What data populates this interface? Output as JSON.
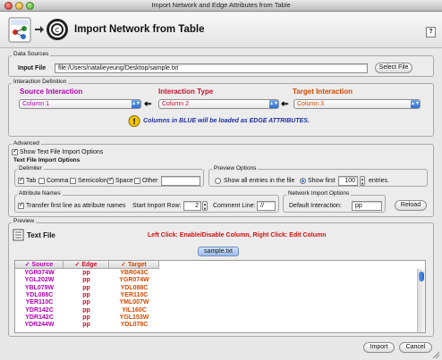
{
  "window": {
    "title": "Import Network and Edge Attributes from Table"
  },
  "header": {
    "title": "Import Network from Table",
    "help_label": "?"
  },
  "data_sources": {
    "legend": "Data Sources",
    "input_label": "Input File",
    "input_value": "file:/Users/natalieyeung/Desktop/sample.txt",
    "select_button": "Select File"
  },
  "interaction": {
    "legend": "Interaction Definition",
    "source_label": "Source Interaction",
    "type_label": "Interaction Type",
    "target_label": "Target Interaction",
    "source_value": "Column 1",
    "type_value": "Column 2",
    "target_value": "Column 3",
    "swap_symbol": "◆▸",
    "note": "Columns in BLUE will be loaded as EDGE ATTRIBUTES.",
    "colors": {
      "source": "#b000b0",
      "type": "#c8102e",
      "target": "#d04a00",
      "note": "#1f2fa6"
    }
  },
  "advanced": {
    "legend": "Advanced",
    "show_text_options": "Show Text File Import Options",
    "text_options_title": "Text File Import Options",
    "delimiter": {
      "legend": "Delimiter",
      "items": [
        {
          "label": "Tab",
          "checked": true
        },
        {
          "label": "Comma",
          "checked": false
        },
        {
          "label": "Semicolon",
          "checked": false
        },
        {
          "label": "Space",
          "checked": true
        },
        {
          "label": "Other",
          "checked": false
        }
      ]
    },
    "preview_options": {
      "legend": "Preview Options",
      "show_all": "Show all entries in the file",
      "show_first": "Show first",
      "first_count": "100",
      "entries": "entries."
    },
    "attribute_names": {
      "legend": "Attribute Names",
      "transfer": "Transfer first line as attribute names",
      "start_row_label": "Start Import Row:",
      "start_row_value": "2",
      "comment_label": "Comment Line:",
      "comment_value": "//"
    },
    "network_options": {
      "legend": "Network Import Options",
      "default_label": "Default Interaction:",
      "default_value": "pp",
      "reload": "Reload"
    }
  },
  "preview": {
    "legend": "Preview",
    "text_file": "Text File",
    "hint": "Left Click: Enable/Disable Column, Right Click: Edit Column",
    "tab": "sample.txt",
    "columns": [
      {
        "name": "Source",
        "color": "#b000b0"
      },
      {
        "name": "Edge",
        "color": "#c8102e"
      },
      {
        "name": "Target",
        "color": "#d04a00"
      }
    ],
    "rows": [
      [
        "YGR074W",
        "pp",
        "YBR043C"
      ],
      [
        "YGL202W",
        "pp",
        "YGR074W"
      ],
      [
        "YBL079W",
        "pp",
        "YDL088C"
      ],
      [
        "YDL088C",
        "pp",
        "YER110C"
      ],
      [
        "YER110C",
        "pp",
        "YML007W"
      ],
      [
        "YDR142C",
        "pp",
        "YIL160C"
      ],
      [
        "YDR142C",
        "pp",
        "YGL153W"
      ],
      [
        "YDR244W",
        "pp",
        "YDL078C"
      ]
    ]
  },
  "footer": {
    "import": "Import",
    "cancel": "Cancel"
  }
}
